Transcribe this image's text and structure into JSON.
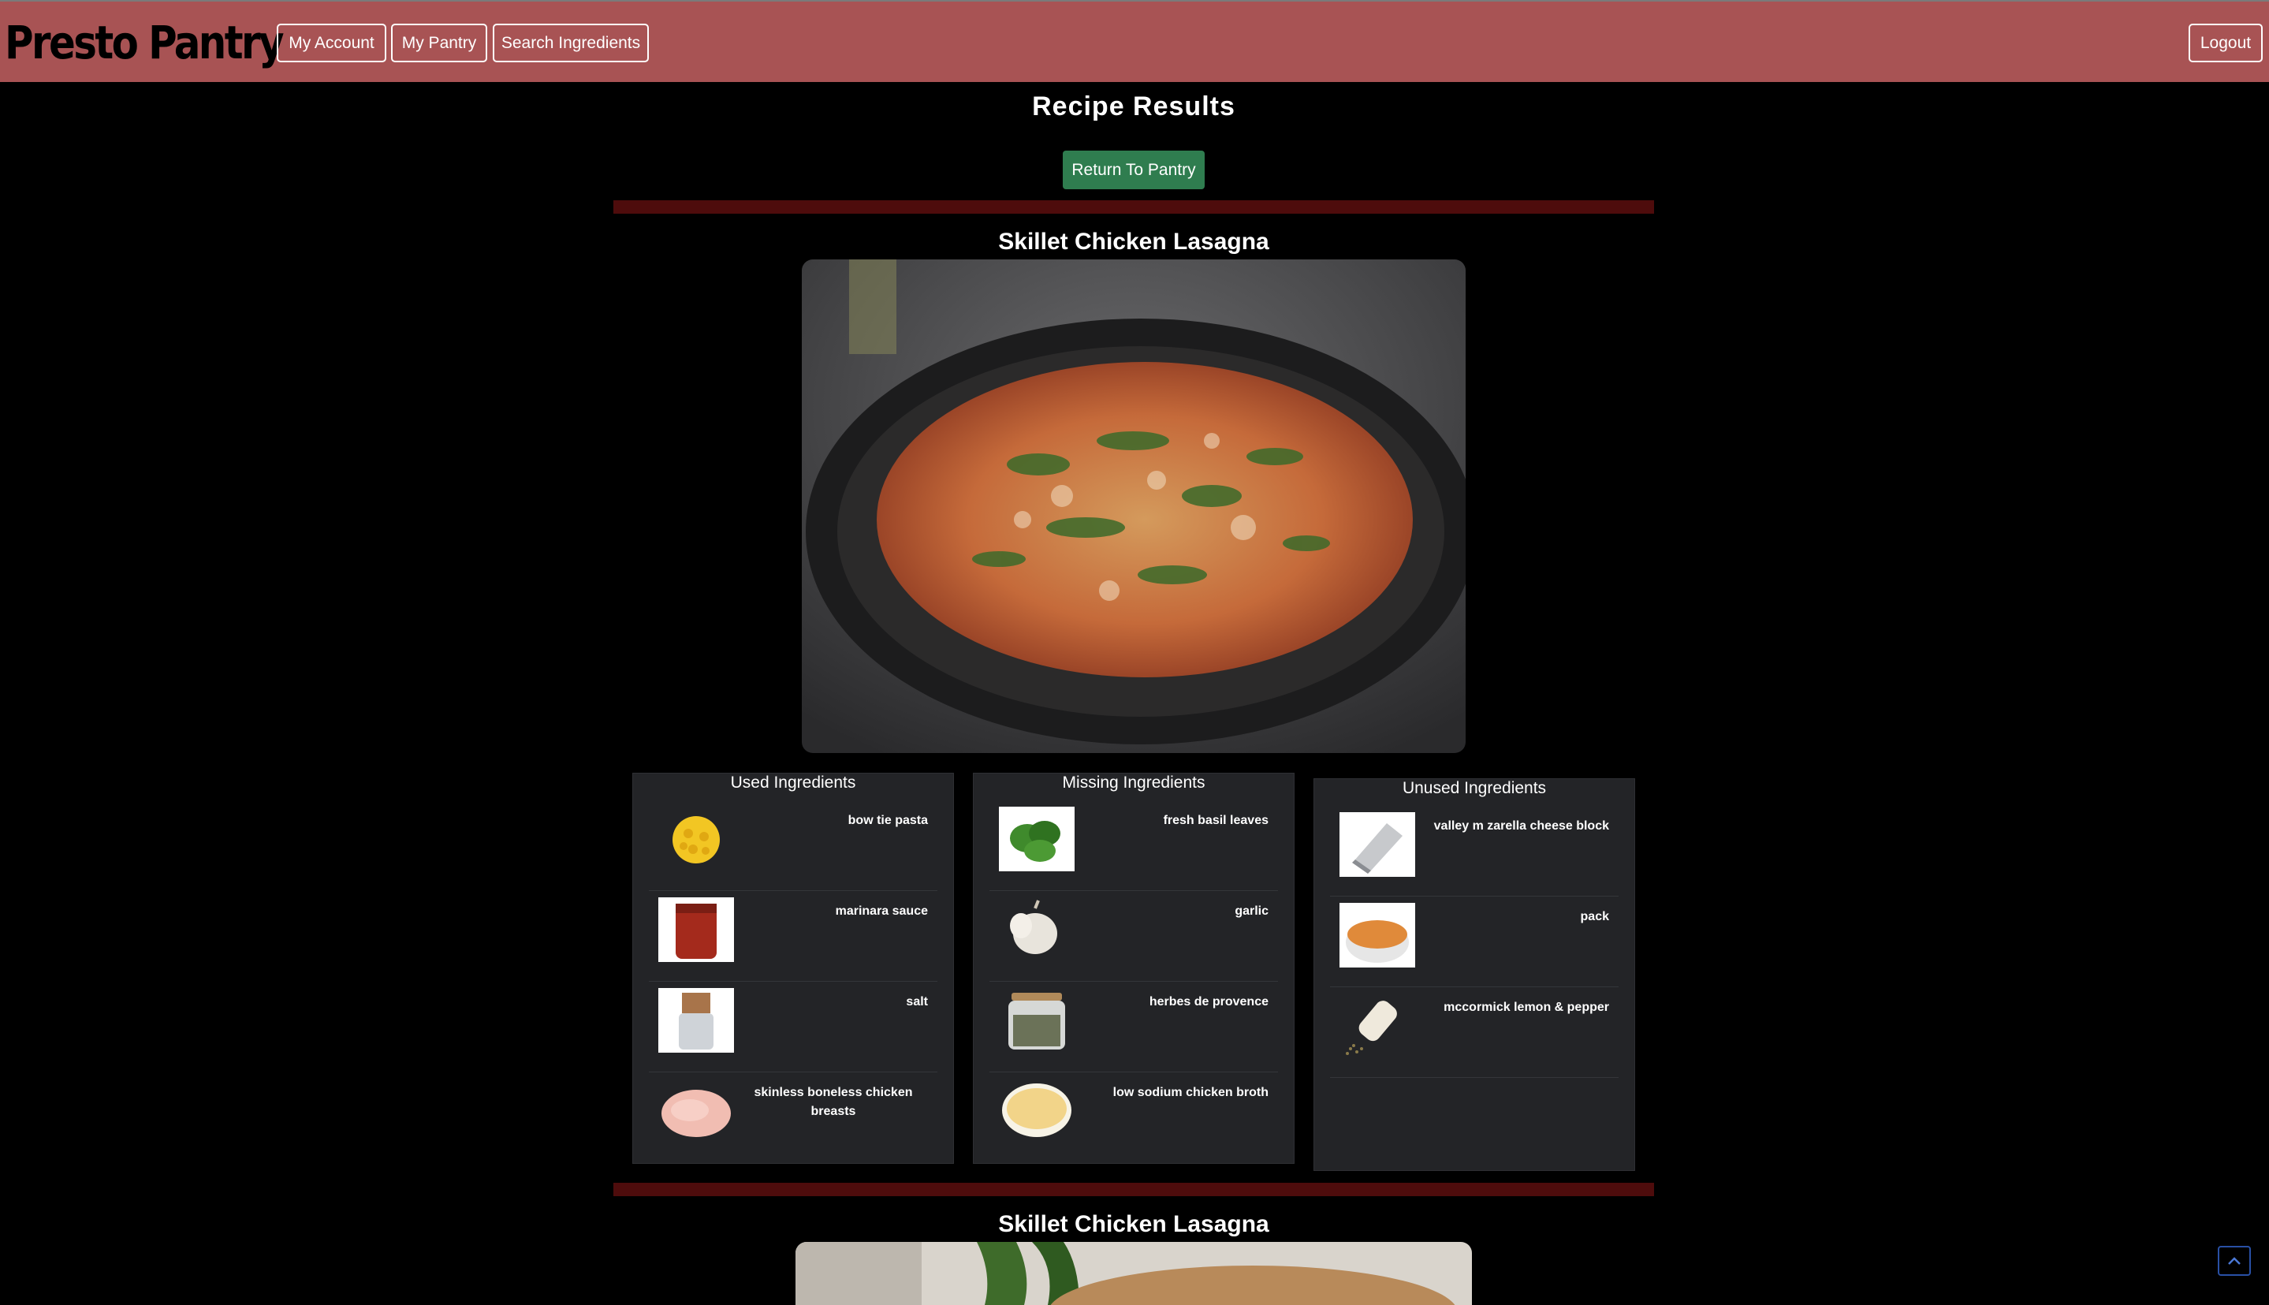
{
  "nav": {
    "brand": "Presto Pantry",
    "my_account": "My Account",
    "my_pantry": "My Pantry",
    "search_ingredients": "Search Ingredients",
    "logout": "Logout"
  },
  "page": {
    "title": "Recipe Results",
    "return_button": "Return To Pantry"
  },
  "recipes": [
    {
      "title": "Skillet Chicken Lasagna",
      "used_heading": "Used Ingredients",
      "missing_heading": "Missing Ingredients",
      "unused_heading": "Unused Ingredients",
      "used": [
        {
          "name": "bow tie pasta",
          "icon": "pasta-image"
        },
        {
          "name": "marinara sauce",
          "icon": "marinara-jar-image"
        },
        {
          "name": "salt",
          "icon": "salt-shaker-image"
        },
        {
          "name": "skinless boneless chicken breasts",
          "icon": "chicken-breast-image"
        }
      ],
      "missing": [
        {
          "name": "fresh basil leaves",
          "icon": "basil-image"
        },
        {
          "name": "garlic",
          "icon": "garlic-image"
        },
        {
          "name": "herbes de provence",
          "icon": "herb-jar-image"
        },
        {
          "name": "low sodium chicken broth",
          "icon": "broth-bowl-image"
        }
      ],
      "unused": [
        {
          "name": "valley m zarella cheese block",
          "icon": "cheese-grater-image"
        },
        {
          "name": "pack",
          "icon": "soup-bowl-image"
        },
        {
          "name": "mccormick lemon & pepper",
          "icon": "pepper-shaker-image"
        }
      ]
    },
    {
      "title": "Skillet Chicken Lasagna"
    }
  ],
  "colors": {
    "navbar": "#a85354",
    "return_button": "#2f7d4f",
    "divider": "#4e0c0c",
    "card": "#232427"
  }
}
